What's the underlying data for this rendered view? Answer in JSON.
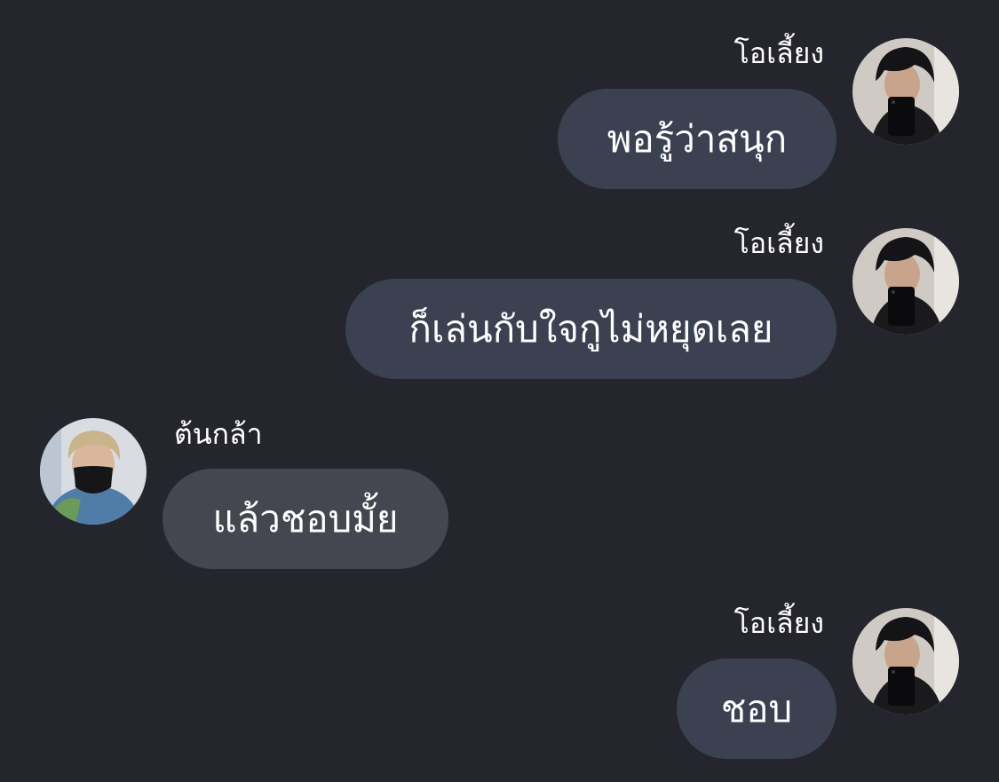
{
  "chat": {
    "messages": [
      {
        "sender": "โอเลี้ยง",
        "text": "พอรู้ว่าสนุก",
        "side": "right"
      },
      {
        "sender": "โอเลี้ยง",
        "text": "ก็เล่นกับใจกูไม่หยุดเลย",
        "side": "right"
      },
      {
        "sender": "ต้นกล้า",
        "text": "แล้วชอบมั้ย",
        "side": "left"
      },
      {
        "sender": "โอเลี้ยง",
        "text": "ชอบ",
        "side": "right"
      }
    ]
  },
  "colors": {
    "background": "#24252d",
    "outgoing_bubble": "#3b4151",
    "incoming_bubble": "#454750",
    "text": "#ffffff"
  }
}
